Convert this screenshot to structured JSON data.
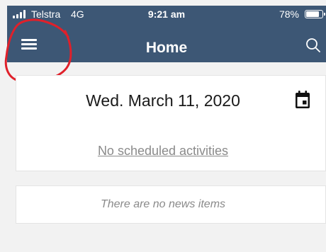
{
  "status_bar": {
    "carrier": "Telstra",
    "network": "4G",
    "time": "9:21 am",
    "battery": "78%",
    "battery_level": 0.78
  },
  "header": {
    "title": "Home",
    "menu_icon": "hamburger-icon",
    "search_icon": "search-icon",
    "background_color": "#3d5775"
  },
  "annotation": {
    "color": "#e0202a"
  },
  "date_card": {
    "date": "Wed. March 11, 2020",
    "calendar_icon": "calendar-icon",
    "activities_text": "No scheduled activities"
  },
  "news_card": {
    "text": "There are no news items"
  }
}
